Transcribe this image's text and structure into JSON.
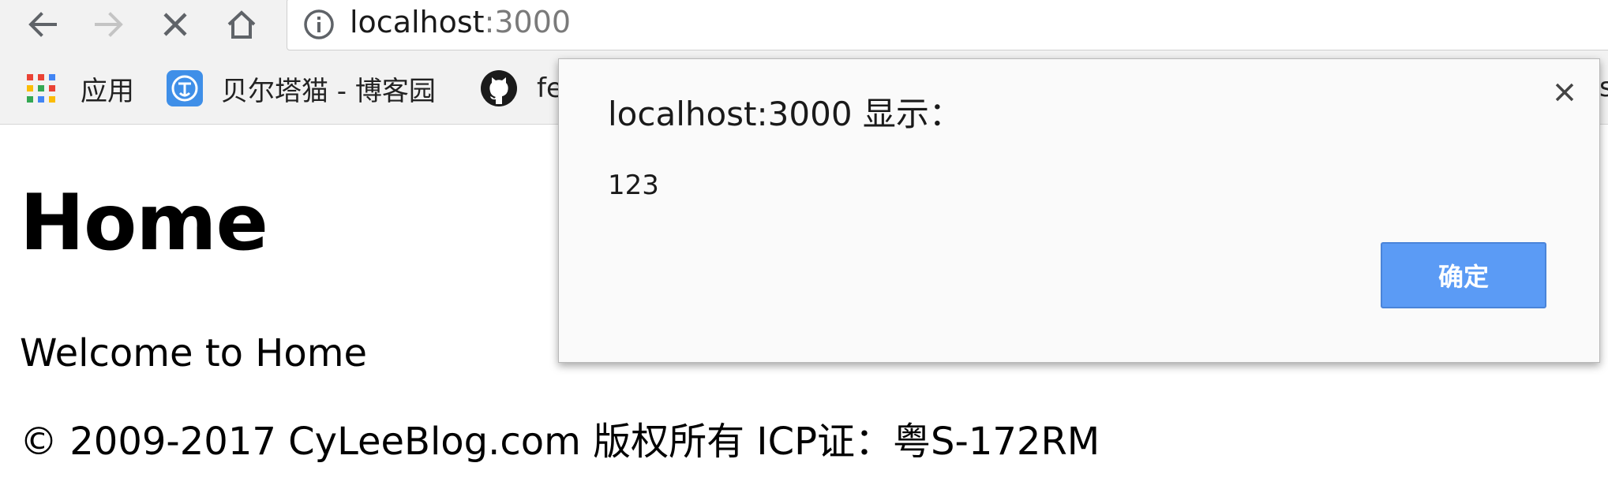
{
  "browser": {
    "address": {
      "host": "localhost",
      "port": ":3000"
    },
    "bookmarks": [
      {
        "label": "应用",
        "icon": "apps-grid-icon"
      },
      {
        "label": "贝尔塔猫 - 博客园",
        "icon": "cnblogs-icon"
      },
      {
        "label": "fe",
        "icon": "github-icon"
      }
    ],
    "bookmark_overflow": "s"
  },
  "page": {
    "heading": "Home",
    "welcome": "Welcome to Home",
    "footer": "© 2009-2017 CyLeeBlog.com 版权所有 ICP证：粤S-172RM"
  },
  "alert": {
    "title": "localhost:3000 显示：",
    "message": "123",
    "ok_label": "确定",
    "close_glyph": "×"
  },
  "colors": {
    "chrome_bg": "#f2f2f2",
    "dialog_button": "#5b9bf5",
    "port_text": "#7a7a7a"
  }
}
